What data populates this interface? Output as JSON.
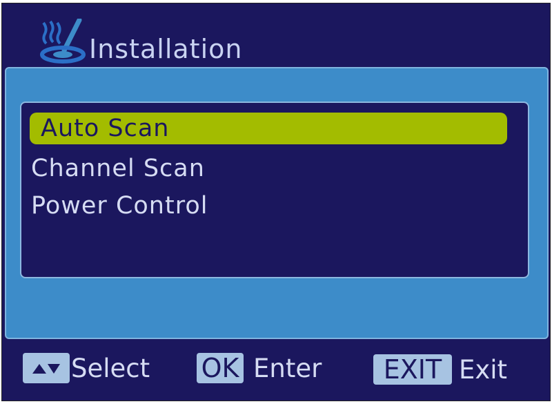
{
  "header": {
    "title": "Installation",
    "icon": "installation-logo-icon"
  },
  "menu": {
    "items": [
      {
        "label": "Auto Scan",
        "selected": true
      },
      {
        "label": "Channel Scan",
        "selected": false
      },
      {
        "label": "Power Control",
        "selected": false
      }
    ]
  },
  "footer": {
    "select": {
      "icon": "up-down-arrows-icon",
      "label": "Select"
    },
    "enter": {
      "key": "OK",
      "label": "Enter"
    },
    "exit": {
      "key": "EXIT",
      "label": "Exit"
    }
  },
  "colors": {
    "background": "#1b175e",
    "panel": "#3d8cc9",
    "highlight": "#a3bc00",
    "text": "#d6dcf3",
    "badge": "#a7c3e2"
  }
}
